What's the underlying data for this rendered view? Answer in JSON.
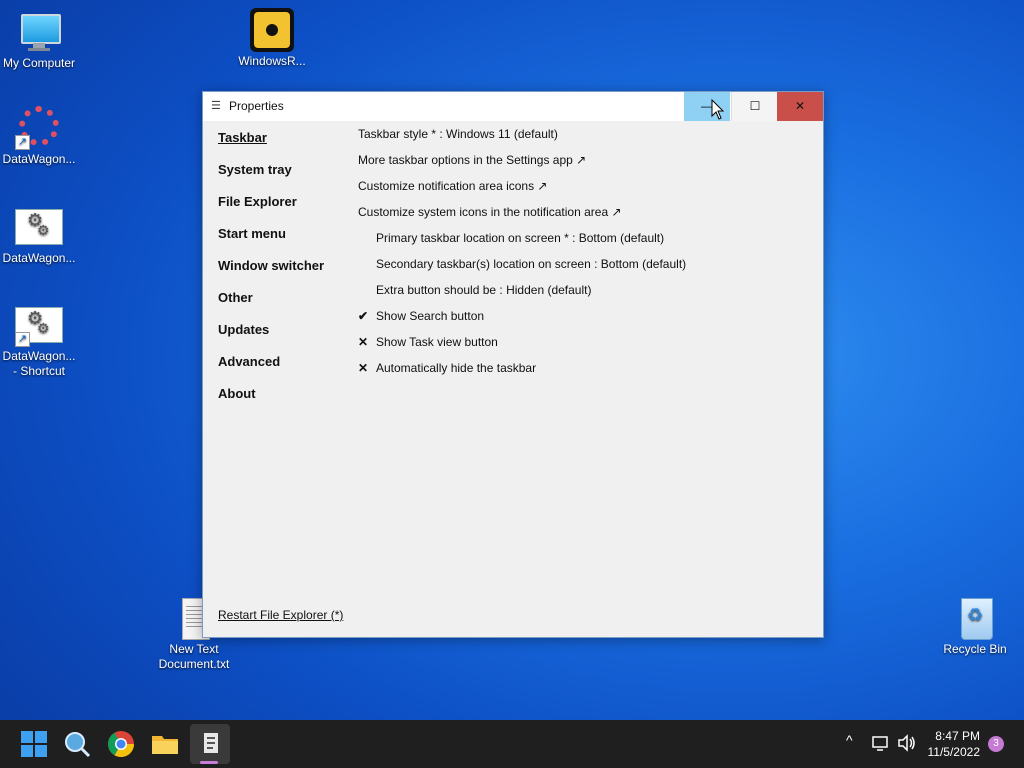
{
  "desktop": {
    "icons": [
      {
        "label": "My Computer"
      },
      {
        "label": "WindowsR..."
      },
      {
        "label": "DataWagon..."
      },
      {
        "label": "DataWagon..."
      },
      {
        "label": "DataWagon...",
        "label2": "- Shortcut"
      },
      {
        "label": "New Text",
        "label2": "Document.txt"
      },
      {
        "label": "Recycle Bin"
      }
    ]
  },
  "window": {
    "title": "Properties",
    "buttons": {
      "minimize": "—",
      "maximize": "☐",
      "close": "✕"
    },
    "nav": [
      "Taskbar",
      "System tray",
      "File Explorer",
      "Start menu",
      "Window switcher",
      "Other",
      "Updates",
      "Advanced",
      "About"
    ],
    "settings": [
      "Taskbar style * : Windows 11 (default)",
      "More taskbar options in the Settings app ↗",
      "Customize notification area icons ↗",
      "Customize system icons in the notification area ↗",
      "Primary taskbar location on screen * : Bottom (default)",
      "Secondary taskbar(s) location on screen : Bottom (default)",
      "Extra button should be : Hidden (default)",
      "Show Search button",
      "Show Task view button",
      "Automatically hide the taskbar"
    ],
    "marks": {
      "check": "✔",
      "cross": "✕"
    },
    "restart": "Restart File Explorer (*)"
  },
  "taskbar": {
    "time": "8:47 PM",
    "date": "11/5/2022",
    "notifications": "3",
    "tray_chevron": "^"
  },
  "colors": {
    "accent": "#8fd0f5",
    "close": "#c9504a",
    "taskbar": "#1f1f1f"
  }
}
